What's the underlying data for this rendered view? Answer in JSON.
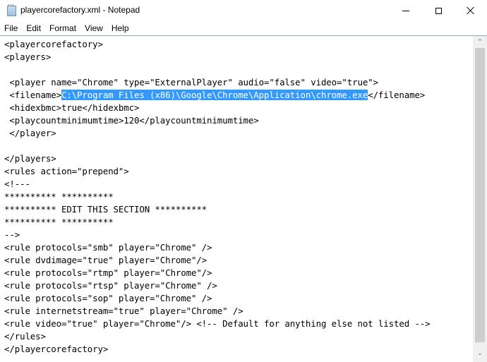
{
  "window": {
    "title": "playercorefactory.xml - Notepad",
    "icon": "notepad-icon",
    "controls": {
      "minimize": "minimize-icon",
      "maximize": "maximize-icon",
      "close": "close-icon"
    }
  },
  "menu": {
    "items": [
      "File",
      "Edit",
      "Format",
      "View",
      "Help"
    ]
  },
  "editor": {
    "lines": [
      "<playercorefactory>",
      "<players>",
      "",
      " <player name=\"Chrome\" type=\"ExternalPlayer\" audio=\"false\" video=\"true\">",
      " <filename>",
      " <hidexbmc>true</hidexbmc>",
      " <playcountminimumtime>120</playcountminimumtime>",
      " </player>",
      "",
      "</players>",
      "<rules action=\"prepend\">",
      "<!---",
      "********** **********",
      "********** EDIT THIS SECTION **********",
      "********** **********",
      "-->",
      "<rule protocols=\"smb\" player=\"Chrome\" />",
      "<rule dvdimage=\"true\" player=\"Chrome\"/>",
      "<rule protocols=\"rtmp\" player=\"Chrome\"/>",
      "<rule protocols=\"rtsp\" player=\"Chrome\" />",
      "<rule protocols=\"sop\" player=\"Chrome\" />",
      "<rule internetstream=\"true\" player=\"Chrome\" />",
      "<rule video=\"true\" player=\"Chrome\"/> <!-- Default for anything else not listed -->",
      "</rules>",
      "</playercorefactory>"
    ],
    "filename_line": {
      "prefix": " <filename>",
      "selected": "C:\\Program Files (x86)\\Google\\Chrome\\Application\\chrome.exe",
      "suffix": "</filename>"
    },
    "selection_color": "#3399ff"
  },
  "scrollbar": {
    "up_arrow": "chevron-up-icon",
    "down_arrow": "chevron-down-icon"
  }
}
